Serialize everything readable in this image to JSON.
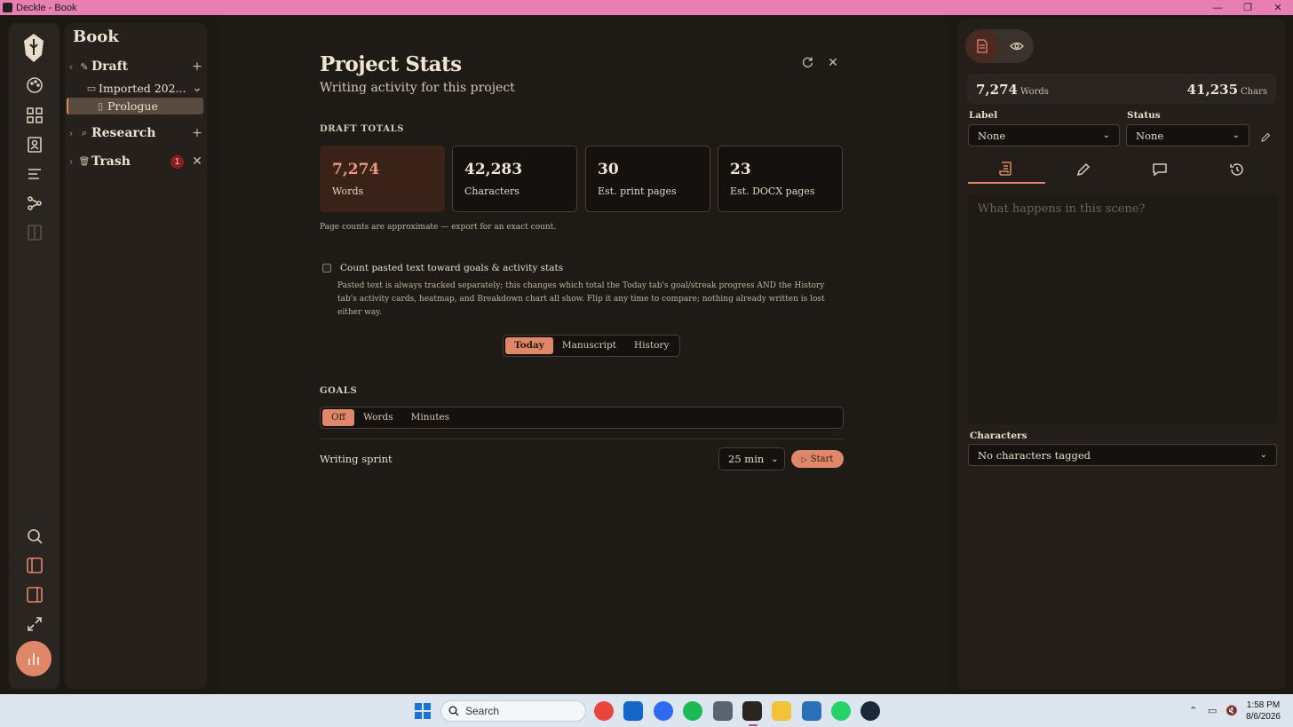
{
  "window": {
    "title": "Deckle - Book",
    "minimize": "—",
    "maximize": "❐",
    "close": "✕"
  },
  "binder": {
    "title": "Book",
    "draft": {
      "label": "Draft",
      "icon": "✎",
      "add": "+"
    },
    "imported": {
      "label": "Imported 202...",
      "icon": "▭"
    },
    "prologue": {
      "label": "Prologue",
      "icon": "▯"
    },
    "research": {
      "label": "Research",
      "icon": "⌕",
      "add": "+"
    },
    "trash": {
      "label": "Trash",
      "icon": "🗑",
      "count": "1",
      "clear": "✕"
    }
  },
  "stats": {
    "title": "Project Stats",
    "subtitle": "Writing activity for this project",
    "section_totals": "DRAFT TOTALS",
    "cards": [
      {
        "value": "7,274",
        "caption": "Words"
      },
      {
        "value": "42,283",
        "caption": "Characters"
      },
      {
        "value": "30",
        "caption": "Est. print pages"
      },
      {
        "value": "23",
        "caption": "Est. DOCX pages"
      }
    ],
    "note": "Page counts are approximate — export for an exact count.",
    "pasted_checkbox": {
      "label": "Count pasted text toward goals & activity stats",
      "checked": false,
      "help": "Pasted text is always tracked separately; this changes which total the Today tab's goal/streak progress AND the History tab's activity cards, heatmap, and Breakdown chart all show. Flip it any time to compare; nothing already written is lost either way."
    },
    "view_tabs": [
      "Today",
      "Manuscript",
      "History"
    ],
    "view_selected": "Today",
    "section_goals": "GOALS",
    "goal_tabs": [
      "Off",
      "Words",
      "Minutes"
    ],
    "goal_selected": "Off",
    "sprint_label": "Writing sprint",
    "sprint_duration": "25 min",
    "start_label": "Start"
  },
  "inspector": {
    "words_value": "7,274",
    "words_label": "Words",
    "chars_value": "41,235",
    "chars_label": "Chars",
    "label_title": "Label",
    "label_value": "None",
    "status_title": "Status",
    "status_value": "None",
    "synopsis_placeholder": "What happens in this scene?",
    "characters_title": "Characters",
    "characters_value": "No characters tagged"
  },
  "taskbar": {
    "search_placeholder": "Search",
    "time": "1:58 PM",
    "date": "8/6/2026"
  },
  "colors": {
    "accent": "#e0876a",
    "titlebar": "#e77fb2",
    "background": "#1c1814"
  }
}
